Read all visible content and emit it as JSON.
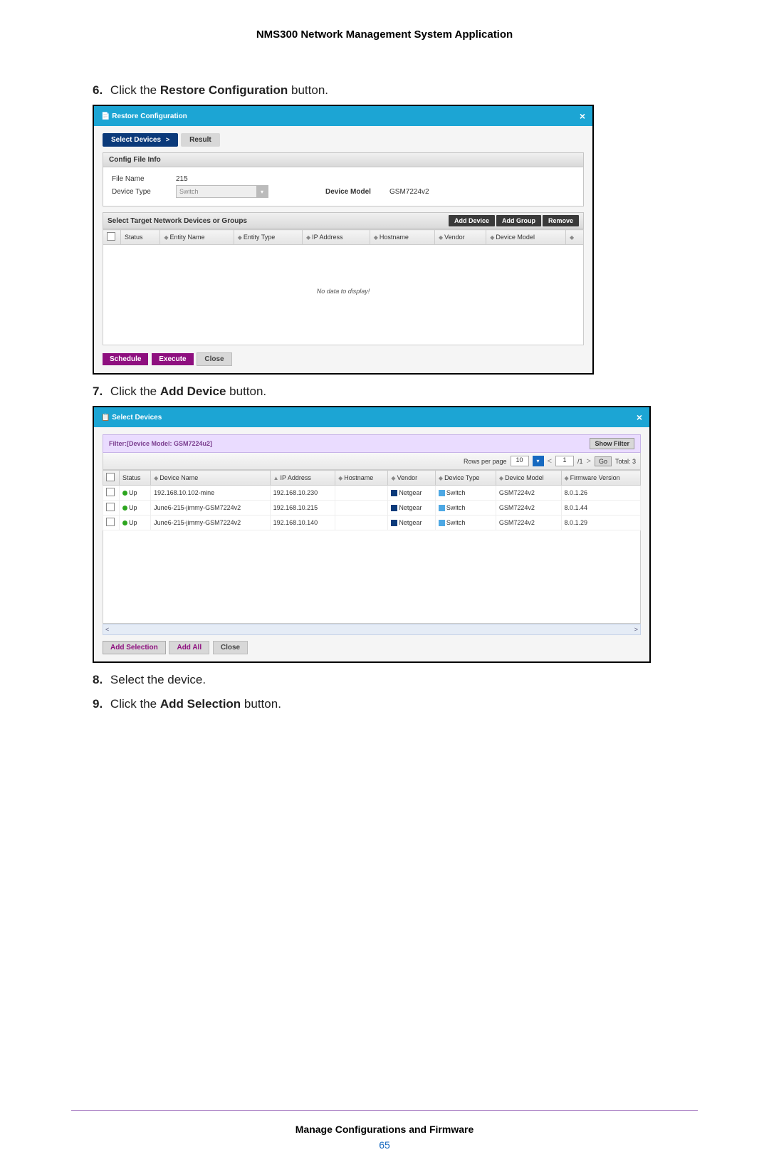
{
  "document": {
    "header_title": "NMS300 Network Management System Application",
    "footer_title": "Manage Configurations and Firmware",
    "page_number": "65"
  },
  "steps": {
    "s6_num": "6.",
    "s6_pre": "Click the ",
    "s6_bold": "Restore Configuration",
    "s6_post": " button.",
    "s7_num": "7.",
    "s7_pre": "Click the ",
    "s7_bold": "Add Device",
    "s7_post": " button.",
    "s8_num": "8.",
    "s8_text": "Select the device.",
    "s9_num": "9.",
    "s9_pre": "Click the ",
    "s9_bold": "Add Selection",
    "s9_post": " button."
  },
  "restore_dialog": {
    "title": "Restore Configuration",
    "close": "×",
    "tab_select": "Select Devices",
    "tab_chevron": ">",
    "tab_result": "Result",
    "section_config_title": "Config File Info",
    "file_name_label": "File Name",
    "file_name_value": "215",
    "device_type_label": "Device Type",
    "device_type_value": "Switch",
    "device_model_label": "Device Model",
    "device_model_value": "GSM7224v2",
    "target_title": "Select Target Network Devices or Groups",
    "btn_add_device": "Add Device",
    "btn_add_group": "Add Group",
    "btn_remove": "Remove",
    "col_status": "Status",
    "col_entity_name": "Entity Name",
    "col_entity_type": "Entity Type",
    "col_ip": "IP Address",
    "col_hostname": "Hostname",
    "col_vendor": "Vendor",
    "col_device_model": "Device Model",
    "no_data": "No data to display!",
    "btn_schedule": "Schedule",
    "btn_execute": "Execute",
    "btn_close": "Close"
  },
  "select_dialog": {
    "title": "Select Devices",
    "close": "×",
    "filter_label": "Filter:[Device Model: GSM7224u2]",
    "show_filter": "Show Filter",
    "rows_per_page_label": "Rows per page",
    "rows_per_page_value": "10",
    "page_current": "1",
    "page_total": "/1",
    "go_label": "Go",
    "total_label": "Total: 3",
    "cols": {
      "status": "Status",
      "device_name": "Device Name",
      "ip": "IP Address",
      "hostname": "Hostname",
      "vendor": "Vendor",
      "device_type": "Device Type",
      "device_model": "Device Model",
      "firmware": "Firmware Version"
    },
    "rows": [
      {
        "status": "Up",
        "name": "192.168.10.102-mine",
        "ip": "192.168.10.230",
        "hostname": "",
        "vendor": "Netgear",
        "type": "Switch",
        "model": "GSM7224v2",
        "fw": "8.0.1.26"
      },
      {
        "status": "Up",
        "name": "June6-215-jimmy-GSM7224v2",
        "ip": "192.168.10.215",
        "hostname": "",
        "vendor": "Netgear",
        "type": "Switch",
        "model": "GSM7224v2",
        "fw": "8.0.1.44"
      },
      {
        "status": "Up",
        "name": "June6-215-jimmy-GSM7224v2",
        "ip": "192.168.10.140",
        "hostname": "",
        "vendor": "Netgear",
        "type": "Switch",
        "model": "GSM7224v2",
        "fw": "8.0.1.29"
      }
    ],
    "scroll_left": "<",
    "scroll_right": ">",
    "btn_add_selection": "Add Selection",
    "btn_add_all": "Add All",
    "btn_close": "Close"
  }
}
